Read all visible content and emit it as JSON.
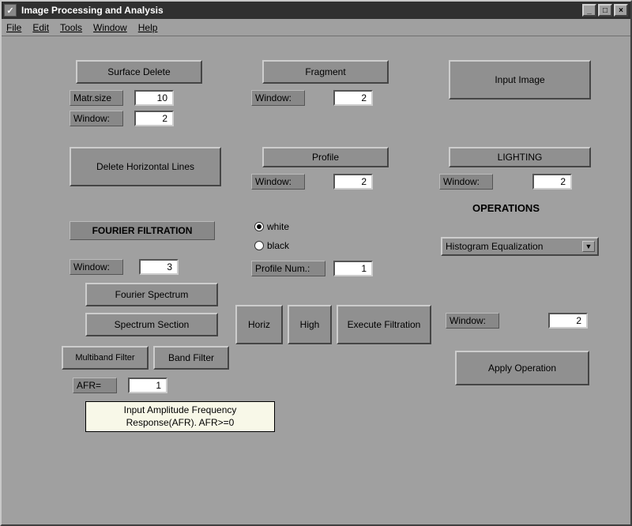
{
  "window": {
    "title": "Image Processing and Analysis"
  },
  "menubar": {
    "file": "File",
    "edit": "Edit",
    "tools": "Tools",
    "window": "Window",
    "help": "Help"
  },
  "buttons": {
    "surface_delete": "Surface Delete",
    "fragment": "Fragment",
    "input_image": "Input Image",
    "delete_horiz": "Delete Horizontal Lines",
    "profile": "Profile",
    "lighting": "LIGHTING",
    "fourier_spectrum": "Fourier Spectrum",
    "spectrum_section": "Spectrum Section",
    "multiband": "Multiband Filter",
    "band_filter": "Band Filter",
    "horiz": "Horiz",
    "high": "High",
    "exec_filtration": "Execute Filtration",
    "apply_operation": "Apply Operation"
  },
  "labels": {
    "matr_size": "Matr.size",
    "window": "Window:",
    "fourier_filtration": "FOURIER FILTRATION",
    "operations": "OPERATIONS",
    "profile_num": "Profile Num.:",
    "afr": "AFR=",
    "white": "white",
    "black": "black"
  },
  "inputs": {
    "matr_size": "10",
    "surf_window": "2",
    "fragment_window": "2",
    "profile_window": "2",
    "lighting_window": "2",
    "fourier_window": "3",
    "profile_num": "1",
    "ops_window": "2",
    "afr": "1"
  },
  "dropdown": {
    "histogram_eq": "Histogram Equalization"
  },
  "radio": {
    "selected": "white"
  },
  "tooltip": {
    "afr": "Input Amplitude Frequency\nResponse(AFR). AFR>=0"
  }
}
